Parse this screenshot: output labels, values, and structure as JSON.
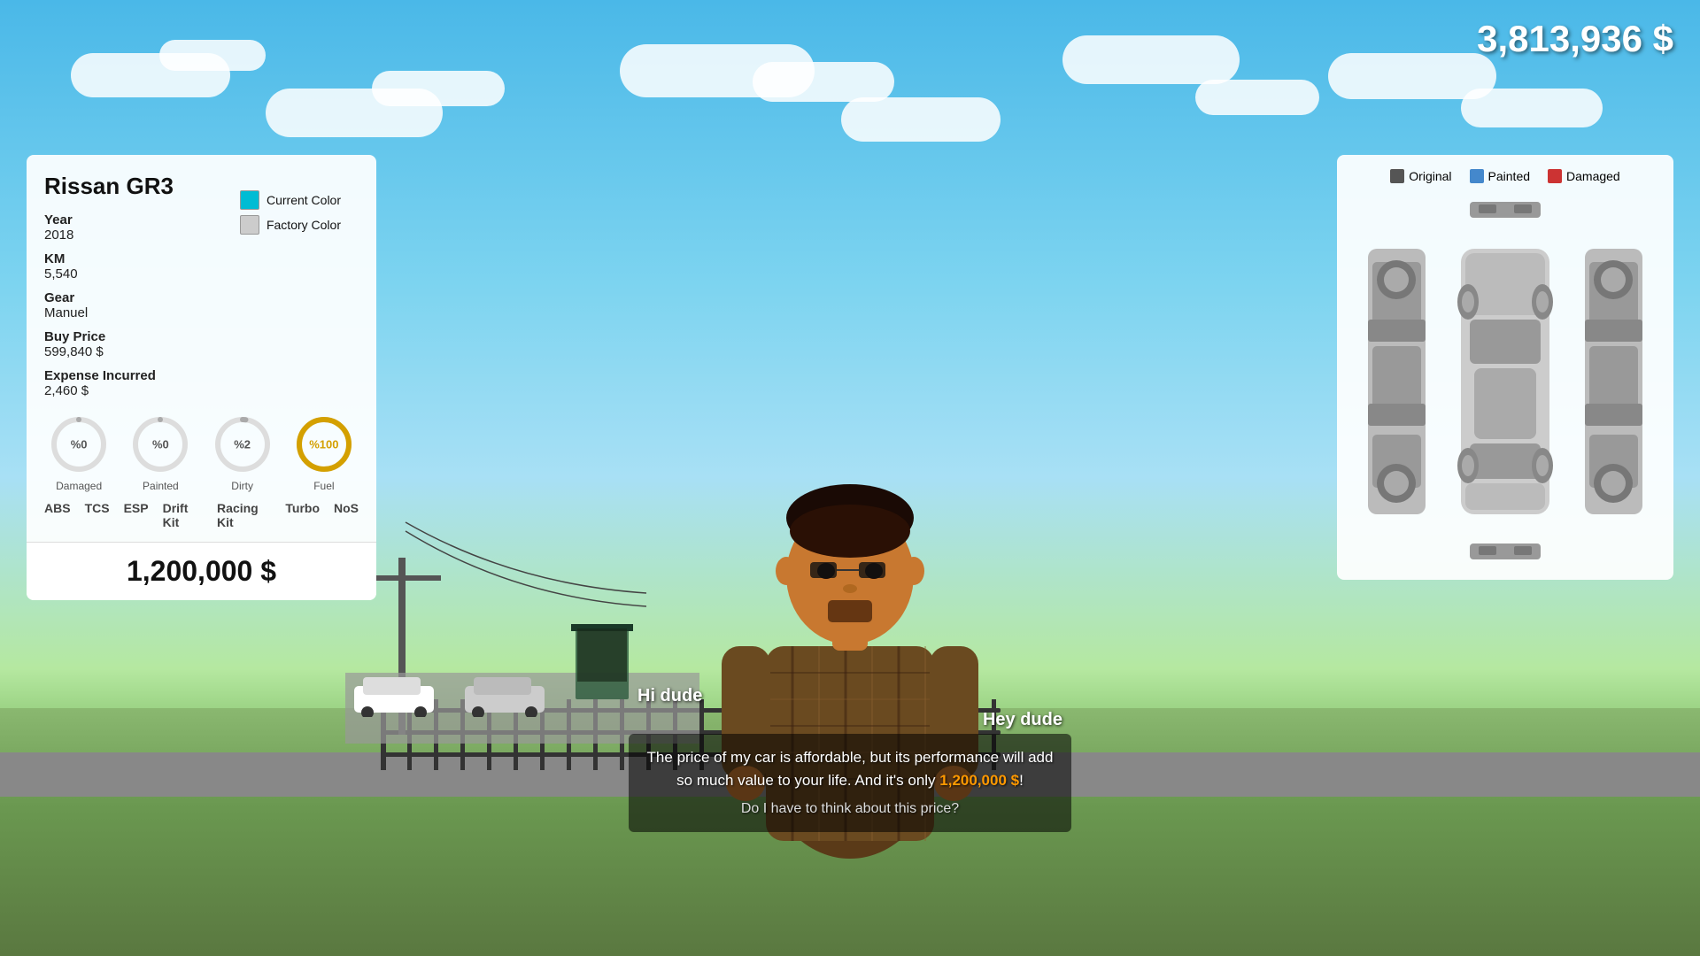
{
  "money": "3,813,936 $",
  "car_panel": {
    "title": "Rissan GR3",
    "current_color_label": "Current Color",
    "factory_color_label": "Factory Color",
    "current_color": "#00bcd4",
    "factory_color": "#cccccc",
    "year_label": "Year",
    "year_value": "2018",
    "km_label": "KM",
    "km_value": "5,540",
    "gear_label": "Gear",
    "gear_value": "Manuel",
    "buy_price_label": "Buy Price",
    "buy_price_value": "599,840 $",
    "expense_label": "Expense Incurred",
    "expense_value": "2,460 $",
    "gauges": [
      {
        "label": "Damaged",
        "value": "0",
        "pct": 0,
        "color": "#aaa"
      },
      {
        "label": "Painted",
        "value": "0",
        "pct": 0,
        "color": "#aaa"
      },
      {
        "label": "Dirty",
        "value": "2",
        "pct": 2,
        "color": "#aaa"
      },
      {
        "label": "Fuel",
        "value": "100",
        "pct": 100,
        "color": "#d4a000"
      }
    ],
    "upgrades": [
      "ABS",
      "TCS",
      "ESP",
      "Drift Kit",
      "Racing Kit",
      "Turbo",
      "NoS"
    ],
    "sale_price": "1,200,000 $"
  },
  "diagram_panel": {
    "legend": [
      {
        "label": "Original",
        "color": "#555555"
      },
      {
        "label": "Painted",
        "color": "#4488cc"
      },
      {
        "label": "Damaged",
        "color": "#cc3333"
      }
    ]
  },
  "dialogue": {
    "speaker_left": "Hi dude",
    "speaker_right": "Hey dude",
    "message": "The price of my car is affordable, but its performance will add so much value to your life. And it's only 1,200,000 $!",
    "price_highlight": "1,200,000 $",
    "question": "Do I have to think about this price?"
  }
}
